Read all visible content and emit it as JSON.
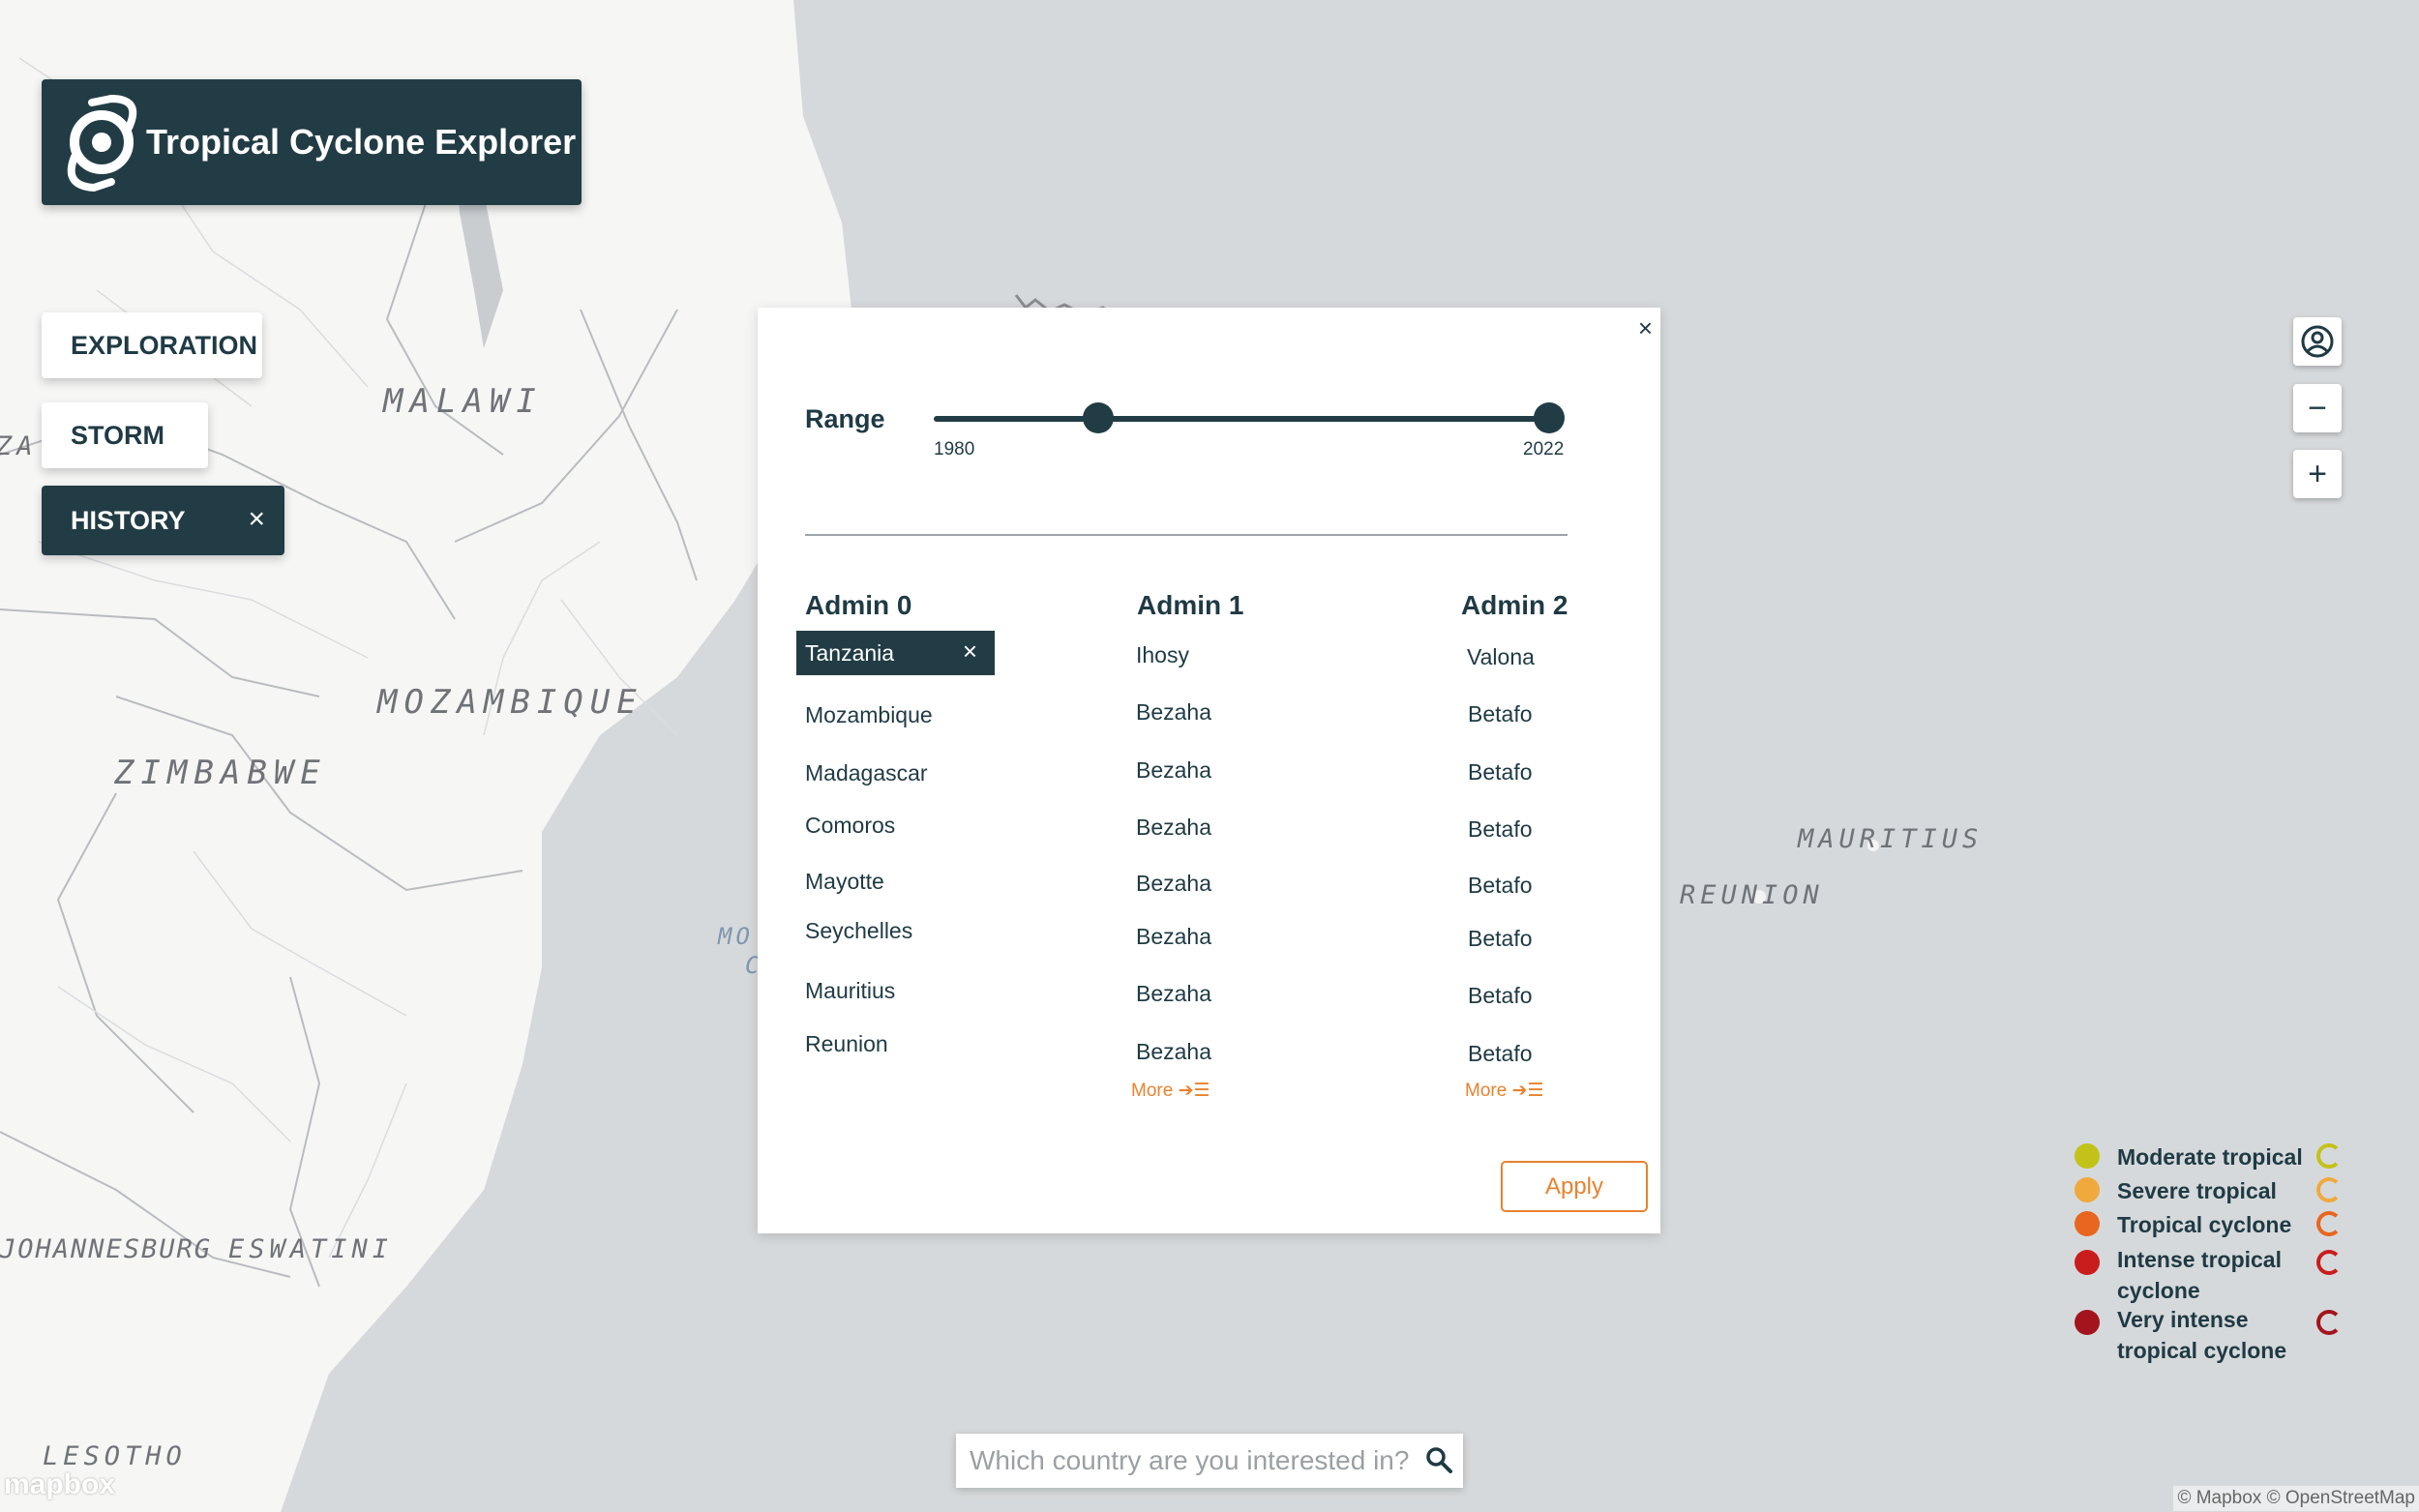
{
  "app": {
    "title": "Tropical Cyclone Explorer"
  },
  "nav": {
    "exploration": "EXPLORATION",
    "storm": "STORM",
    "history": "HISTORY",
    "close_glyph": "×"
  },
  "map_labels": {
    "malawi": "MALAWI",
    "mozambique": "MOZAMBIQUE",
    "zimbabwe": "ZIMBABWE",
    "mauritius": "MAURITIUS",
    "reunion": "REUNION",
    "johannesburg": "JOHANNESBURG",
    "eswatini": "ESWATINI",
    "lesotho": "LESOTHO",
    "za": "ZA",
    "mo": "MO",
    "c": "C"
  },
  "panel": {
    "close_glyph": "×",
    "range": {
      "label": "Range",
      "min_label": "1980",
      "max_label": "2022",
      "selected_from_fraction": 0.27,
      "selected_to_fraction": 1.0
    },
    "admin0": {
      "header": "Admin 0",
      "selected": "Tanzania",
      "items": [
        "Mozambique",
        "Madagascar",
        "Comoros",
        "Mayotte",
        "Seychelles",
        "Mauritius",
        "Reunion"
      ]
    },
    "admin1": {
      "header": "Admin 1",
      "items": [
        "Ihosy",
        "Bezaha",
        "Bezaha",
        "Bezaha",
        "Bezaha",
        "Bezaha",
        "Bezaha",
        "Bezaha"
      ],
      "more": "More ➔☰"
    },
    "admin2": {
      "header": "Admin 2",
      "items": [
        "Valona",
        "Betafo",
        "Betafo",
        "Betafo",
        "Betafo",
        "Betafo",
        "Betafo",
        "Betafo"
      ],
      "more": "More ➔☰"
    },
    "apply": "Apply"
  },
  "controls": {
    "zoom_out": "−",
    "zoom_in": "+"
  },
  "legend": [
    {
      "label": "Moderate tropical",
      "color": "#c2c21a"
    },
    {
      "label": "Severe tropical",
      "color": "#f0a93c"
    },
    {
      "label": "Tropical cyclone",
      "color": "#e8661f"
    },
    {
      "label": "Intense tropical cyclone",
      "color": "#c91d1d"
    },
    {
      "label": "Very intense tropical cyclone",
      "color": "#a3141c"
    }
  ],
  "search": {
    "placeholder": "Which country are you interested in?"
  },
  "footer": {
    "mapbox": "mapbox",
    "attribution": "© Mapbox © OpenStreetMap"
  }
}
